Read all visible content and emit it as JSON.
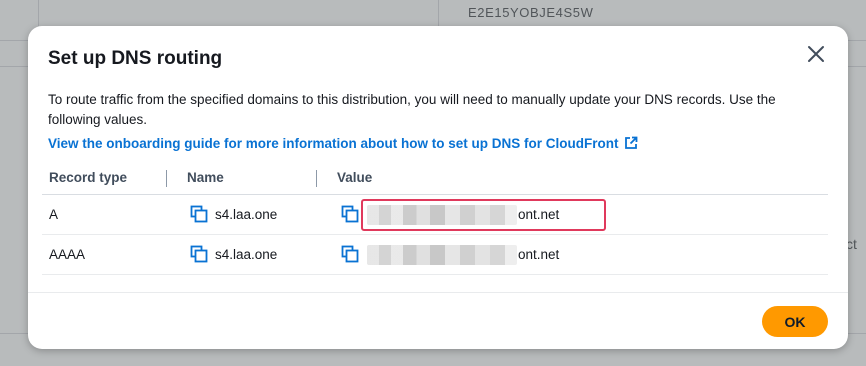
{
  "background": {
    "distribution_code": "E2E15YOBJE4S5W",
    "partial_text": "ct"
  },
  "modal": {
    "title": "Set up DNS routing",
    "description": "To route traffic from the specified domains to this distribution, you will need to manually update your DNS records. Use the following values.",
    "guide_link": "View the onboarding guide for more information about how to set up DNS for CloudFront",
    "columns": [
      "Record type",
      "Name",
      "Value"
    ],
    "rows": [
      {
        "record_type": "A",
        "name": "s4.laa.one",
        "value_suffix": "ont.net"
      },
      {
        "record_type": "AAAA",
        "name": "s4.laa.one",
        "value_suffix": "ont.net"
      }
    ],
    "ok_label": "OK"
  },
  "colors": {
    "primary_button": "#ff9900",
    "link": "#0972d3",
    "highlight": "#e0395c"
  },
  "icons": [
    "close-icon",
    "external-link-icon",
    "copy-icon"
  ]
}
